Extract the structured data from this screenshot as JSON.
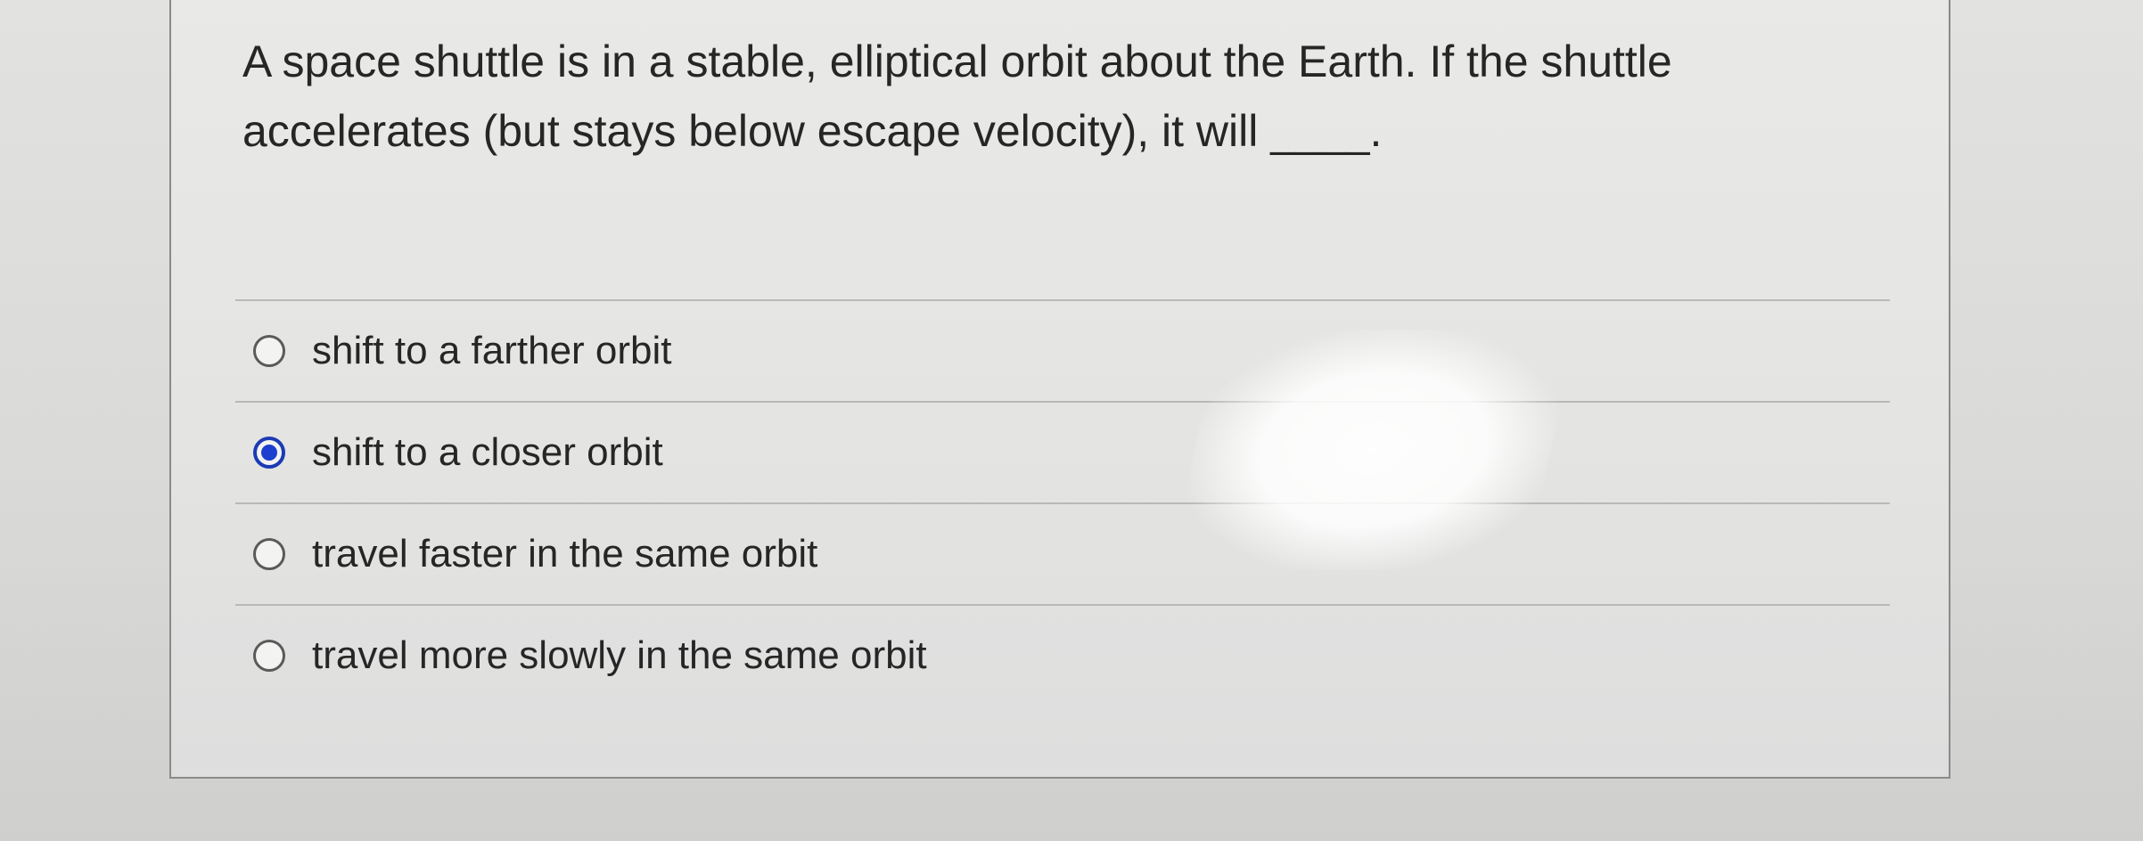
{
  "question": {
    "line1": "A space shuttle is in a stable, elliptical orbit about the Earth.  If the shuttle",
    "line2": "accelerates (but stays below escape velocity), it will ____."
  },
  "answers": [
    {
      "label": "shift to a farther orbit",
      "selected": false
    },
    {
      "label": "shift to a closer orbit",
      "selected": true
    },
    {
      "label": "travel faster in the same orbit",
      "selected": false
    },
    {
      "label": "travel more slowly in the same orbit",
      "selected": false
    }
  ],
  "colors": {
    "selected_radio": "#1c3fd0",
    "text": "#262626"
  },
  "icons": {
    "radio_unselected": "radio-button-empty-icon",
    "radio_selected": "radio-button-filled-icon"
  }
}
